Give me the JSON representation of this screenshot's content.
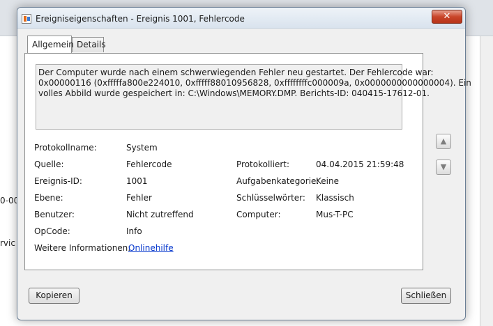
{
  "background": {
    "fragments": [
      "0-00",
      "rvic"
    ]
  },
  "dialog": {
    "title": "Ereigniseigenschaften - Ereignis 1001, Fehlercode",
    "close_glyph": "✕",
    "tabs": [
      {
        "label": "Allgemein",
        "active": true
      },
      {
        "label": "Details",
        "active": false
      }
    ],
    "description_lines": [
      "Der Computer wurde nach einem schwerwiegenden Fehler neu gestartet. Der Fehlercode war:",
      "0x00000116 (0xfffffa800e224010, 0xfffff88010956828, 0xffffffffc000009a, 0x0000000000000004). Ein",
      "volles Abbild wurde gespeichert in: C:\\Windows\\MEMORY.DMP. Berichts-ID: 040415-17612-01."
    ],
    "fields": {
      "protokollname": {
        "label": "Protokollname:",
        "value": "System"
      },
      "quelle": {
        "label": "Quelle:",
        "value": "Fehlercode"
      },
      "protokolliert": {
        "label": "Protokolliert:",
        "value": "04.04.2015 21:59:48"
      },
      "ereignis_id": {
        "label": "Ereignis-ID:",
        "value": "1001"
      },
      "aufgabenkategorie": {
        "label": "Aufgabenkategorie:",
        "value": "Keine"
      },
      "ebene": {
        "label": "Ebene:",
        "value": "Fehler"
      },
      "schluesselwoerter": {
        "label": "Schlüsselwörter:",
        "value": "Klassisch"
      },
      "benutzer": {
        "label": "Benutzer:",
        "value": "Nicht zutreffend"
      },
      "computer": {
        "label": "Computer:",
        "value": "Mus-T-PC"
      },
      "opcode": {
        "label": "OpCode:",
        "value": "Info"
      },
      "weitere": {
        "label": "Weitere Informationen:",
        "value": "Onlinehilfe"
      }
    },
    "scroll": {
      "up_icon": "▲",
      "down_icon": "▼"
    },
    "buttons": {
      "copy": "Kopieren",
      "close": "Schließen"
    }
  }
}
